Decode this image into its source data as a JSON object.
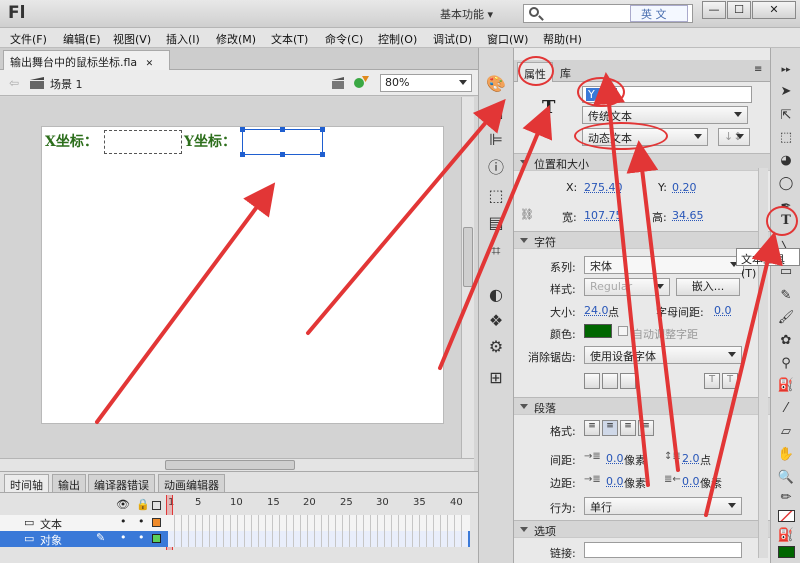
{
  "app": {
    "logo": "Fl",
    "workspace": "基本功能",
    "workspace_arrow": "▾",
    "ime_label": "英 文"
  },
  "window_buttons": {
    "minimize": "—",
    "maximize": "☐",
    "close": "✕"
  },
  "menu": [
    "文件(F)",
    "编辑(E)",
    "视图(V)",
    "插入(I)",
    "修改(M)",
    "文本(T)",
    "命令(C)",
    "控制(O)",
    "调试(D)",
    "窗口(W)",
    "帮助(H)"
  ],
  "document": {
    "tab_title": "输出舞台中的鼠标坐标.fla",
    "tab_close": "✕",
    "scene_label": "场景 1",
    "zoom": "80%"
  },
  "stage": {
    "x_label": "X坐标：",
    "y_label": "Y坐标："
  },
  "timeline": {
    "tabs": [
      "时间轴",
      "输出",
      "编译器错误",
      "动画编辑器"
    ],
    "frame_numbers": [
      "1",
      "5",
      "10",
      "15",
      "20",
      "25",
      "30",
      "35",
      "40"
    ],
    "layers": [
      {
        "name": "文本",
        "selected": false
      },
      {
        "name": "对象",
        "selected": true
      }
    ]
  },
  "props": {
    "tab_properties": "属性",
    "tab_library": "库",
    "instance_name": "Y_txt",
    "text_type": "传统文本",
    "text_mode": "动态文本",
    "tool_glyph": "T",
    "sec_position": "位置和大小",
    "x_label": "X:",
    "x_value": "275.40",
    "y_label": "Y:",
    "y_value": "0.20",
    "w_label": "宽:",
    "w_value": "107.75",
    "h_label": "高:",
    "h_value": "34.65",
    "sec_char": "字符",
    "family_label": "系列:",
    "family_value": "宋体",
    "style_label": "样式:",
    "style_value": "Regular",
    "embed_label": "嵌入...",
    "size_label": "大小:",
    "size_value": "24.0",
    "size_unit": "点",
    "spacing_label": "字母间距:",
    "spacing_value": "0.0",
    "color_label": "颜色:",
    "text_color": "#006600",
    "autokern_label": "自动调整字距",
    "aa_label": "消除锯齿:",
    "aa_value": "使用设备字体",
    "sec_para": "段落",
    "format_label": "格式:",
    "gap_label": "间距:",
    "gap_value": "0.0",
    "gap_unit": "像素",
    "linespace_value": "2.0",
    "linespace_unit": "点",
    "margin_label": "边距:",
    "margin_value": "0.0",
    "margin_unit": "像素",
    "margin_right_value": "0.0",
    "margin_right_unit": "像素",
    "behavior_label": "行为:",
    "behavior_value": "单行",
    "sec_options": "选项",
    "link_label": "链接:"
  },
  "tooltip": "文本工具(T)",
  "colors": {
    "annotation_red": "#e23636",
    "selection_blue": "#3a79d8"
  }
}
